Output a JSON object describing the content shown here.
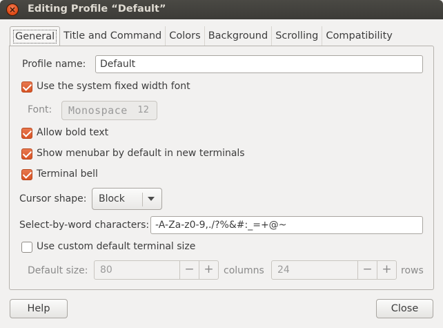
{
  "window": {
    "title": "Editing Profile “Default”",
    "close_icon": "×"
  },
  "tabs": [
    {
      "label": "General"
    },
    {
      "label": "Title and Command"
    },
    {
      "label": "Colors"
    },
    {
      "label": "Background"
    },
    {
      "label": "Scrolling"
    },
    {
      "label": "Compatibility"
    }
  ],
  "general": {
    "profile_name_label": "Profile name:",
    "profile_name_value": "Default",
    "use_system_font_label": "Use the system fixed width font",
    "use_system_font_checked": true,
    "font_label": "Font:",
    "font_name": "Monospace",
    "font_size": "12",
    "allow_bold_label": "Allow bold text",
    "allow_bold_checked": true,
    "show_menubar_label": "Show menubar by default in new terminals",
    "show_menubar_checked": true,
    "terminal_bell_label": "Terminal bell",
    "terminal_bell_checked": true,
    "cursor_shape_label": "Cursor shape:",
    "cursor_shape_value": "Block",
    "select_by_word_label": "Select-by-word characters:",
    "select_by_word_value": "-A-Za-z0-9,./?%&#:_=+@~",
    "custom_size_label": "Use custom default terminal size",
    "custom_size_checked": false,
    "default_size_label": "Default size:",
    "columns_value": "80",
    "columns_label": "columns",
    "rows_value": "24",
    "rows_label": "rows",
    "minus": "−",
    "plus": "+"
  },
  "buttons": {
    "help": "Help",
    "close": "Close"
  },
  "colors": {
    "accent": "#dd4814",
    "titlebar": "#3c3b37",
    "background": "#f2f1f0"
  }
}
